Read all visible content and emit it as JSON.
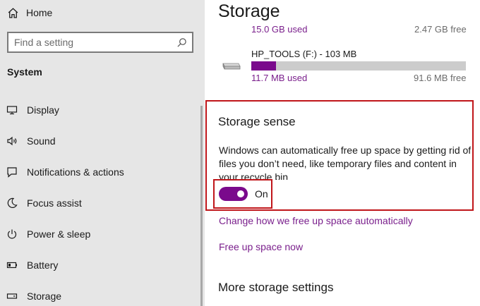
{
  "sidebar": {
    "home_label": "Home",
    "search_placeholder": "Find a setting",
    "section_label": "System",
    "items": [
      {
        "label": "Display",
        "icon": "display-icon"
      },
      {
        "label": "Sound",
        "icon": "sound-icon"
      },
      {
        "label": "Notifications & actions",
        "icon": "notifications-icon"
      },
      {
        "label": "Focus assist",
        "icon": "moon-icon"
      },
      {
        "label": "Power & sleep",
        "icon": "power-icon"
      },
      {
        "label": "Battery",
        "icon": "battery-icon"
      },
      {
        "label": "Storage",
        "icon": "storage-icon"
      }
    ]
  },
  "main": {
    "title": "Storage",
    "drive_prev": {
      "used": "15.0 GB used",
      "free": "2.47 GB free"
    },
    "drive": {
      "name": "HP_TOOLS (F:) - 103 MB",
      "used": "11.7 MB used",
      "free": "91.6 MB free",
      "used_fraction": 0.114
    },
    "storage_sense": {
      "title": "Storage sense",
      "description": "Windows can automatically free up space by getting rid of files you don’t need, like temporary files and content in your recycle bin",
      "toggle_state": "On"
    },
    "links": {
      "change_how": "Change how we free up space automatically",
      "free_up_now": "Free up space now"
    },
    "more_heading": "More storage settings"
  },
  "colors": {
    "accent": "#7a0a8c",
    "link": "#7a1f8c",
    "highlight": "#c0161a",
    "sidebar_bg": "#e6e6e6"
  }
}
